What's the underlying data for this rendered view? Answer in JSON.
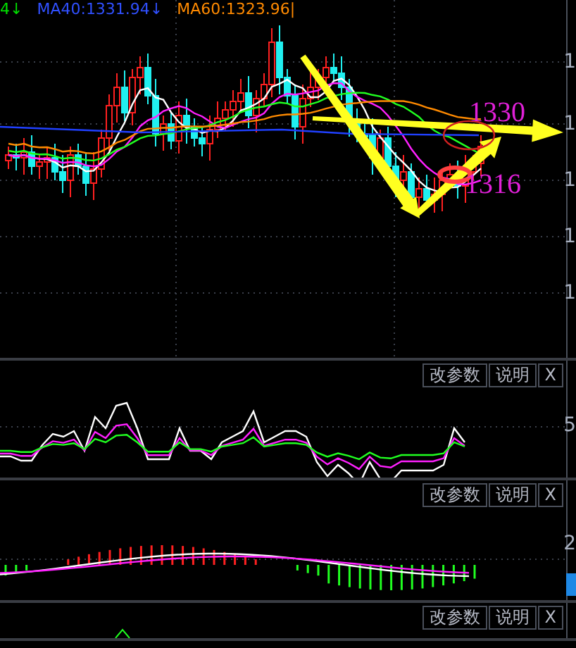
{
  "header": {
    "items": [
      {
        "text": "4↓",
        "color": "#00e000"
      },
      {
        "text": "MA40:1331.94↓",
        "color": "#3050ff"
      },
      {
        "text": "MA60:1323.96|",
        "color": "#ff8a00"
      }
    ]
  },
  "main_panel": {
    "axis_labels": [
      "1",
      "1",
      "1",
      "1",
      "1"
    ],
    "annotations": [
      {
        "text": "1330"
      },
      {
        "text": "1316"
      }
    ]
  },
  "sub_panels": [
    {
      "buttons": [
        "改参数",
        "说明",
        "X"
      ],
      "axis_label": "5"
    },
    {
      "buttons": [
        "改参数",
        "说明",
        "X"
      ],
      "axis_label": "2"
    },
    {
      "buttons": [
        "改参数",
        "说明",
        "X"
      ]
    }
  ]
}
